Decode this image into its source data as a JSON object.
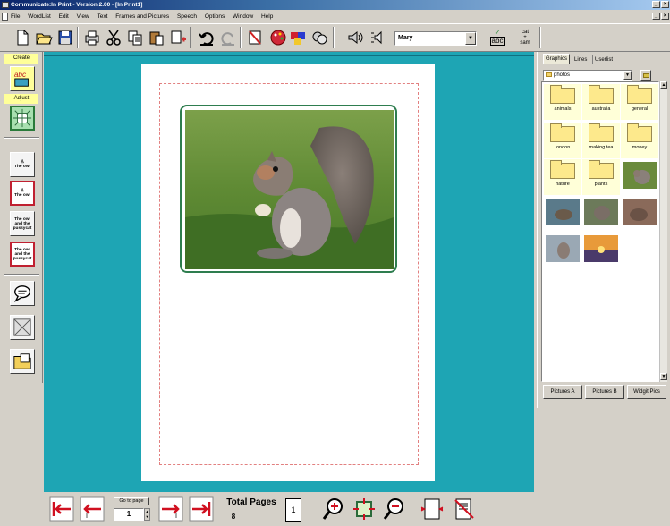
{
  "window": {
    "title": "Communicate:In Print - Version 2.00 - [In Print1]"
  },
  "menu": [
    "File",
    "WordList",
    "Edit",
    "View",
    "Text",
    "Frames and Pictures",
    "Speech",
    "Options",
    "Window",
    "Help"
  ],
  "toolbar": {
    "voice_value": "Mary",
    "spell_label": "abc",
    "symbol_label_top": "cat",
    "symbol_label_mid": "+",
    "symbol_label_bot": "sam"
  },
  "left_panel": {
    "create_label": "Create",
    "adjust_label": "Adjust",
    "card1_text": "The owl",
    "card2_text": "The owl",
    "card3_text": "The owl and the pussycat",
    "card4_text": "The owl and the pussycat",
    "abc_label": "abc"
  },
  "right_panel": {
    "tabs": [
      "Graphics",
      "Lines",
      "Userlist"
    ],
    "folder_value": "photos",
    "folders": [
      "animals",
      "australia",
      "general",
      "london",
      "making tea",
      "money",
      "nature",
      "plants"
    ],
    "buttons": [
      "Pictures A",
      "Pictures B",
      "Widgit Pics"
    ]
  },
  "bottom": {
    "goto_label": "Go to page",
    "goto_value": "1",
    "total_pages_label": "Total Pages",
    "total_pages_value": "8",
    "page_indicator": "1"
  },
  "colors": {
    "workarea": "#1ea5b4",
    "frame": "#2e7d4f",
    "highlight": "#ffff99"
  }
}
